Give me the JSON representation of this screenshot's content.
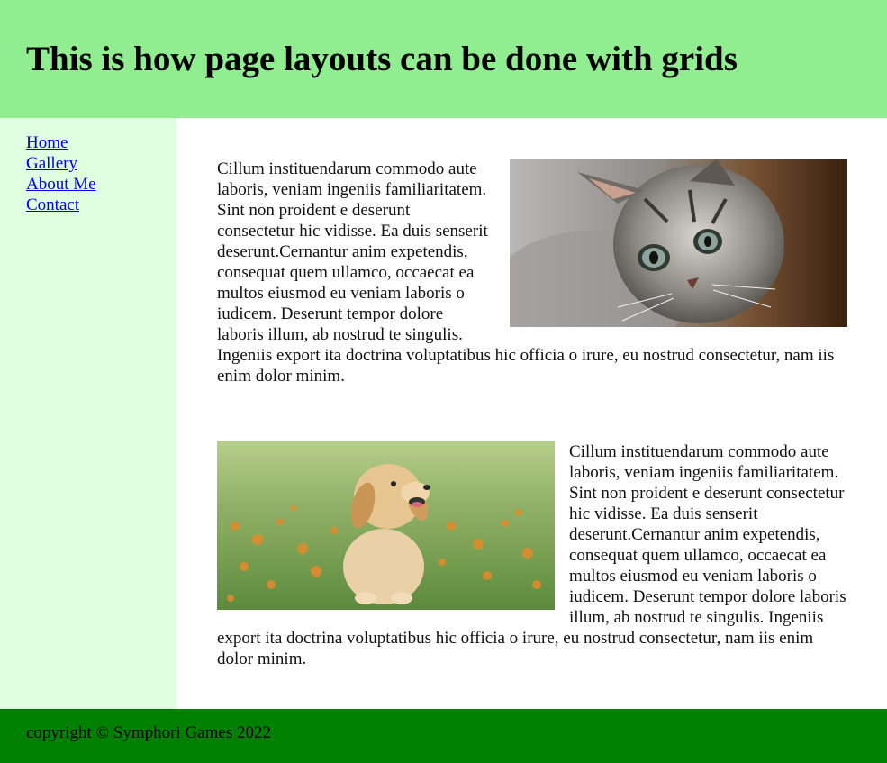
{
  "header": {
    "title": "This is how page layouts can be done with grids"
  },
  "nav": {
    "links": [
      "Home",
      "Gallery",
      "About Me",
      "Contact"
    ]
  },
  "articles": [
    {
      "image": "kitten-photo",
      "image_position": "right",
      "text": "Cillum instituendarum commodo aute laboris, veniam ingeniis familiaritatem. Sint non proident e deserunt consectetur hic vidisse. Ea duis senserit deserunt.Cernantur anim expetendis, consequat quem ullamco, occaecat ea multos eiusmod eu veniam laboris o iudicem. Deserunt tempor dolore laboris illum, ab nostrud te singulis. Ingeniis export ita doctrina voluptatibus hic officia o irure, eu nostrud consectetur, nam iis enim dolor minim."
    },
    {
      "image": "puppy-photo",
      "image_position": "left",
      "text": "Cillum instituendarum commodo aute laboris, veniam ingeniis familiaritatem. Sint non proident e deserunt consectetur hic vidisse. Ea duis senserit deserunt.Cernantur anim expetendis, consequat quem ullamco, occaecat ea multos eiusmod eu veniam laboris o iudicem. Deserunt tempor dolore laboris illum, ab nostrud te singulis. Ingeniis export ita doctrina voluptatibus hic officia o irure, eu nostrud consectetur, nam iis enim dolor minim."
    }
  ],
  "footer": {
    "text": "copyright © Symphori Games 2022"
  },
  "colors": {
    "header_bg": "#90ee90",
    "nav_bg": "#e0ffe0",
    "footer_bg": "#008000",
    "link": "#0000ee"
  }
}
